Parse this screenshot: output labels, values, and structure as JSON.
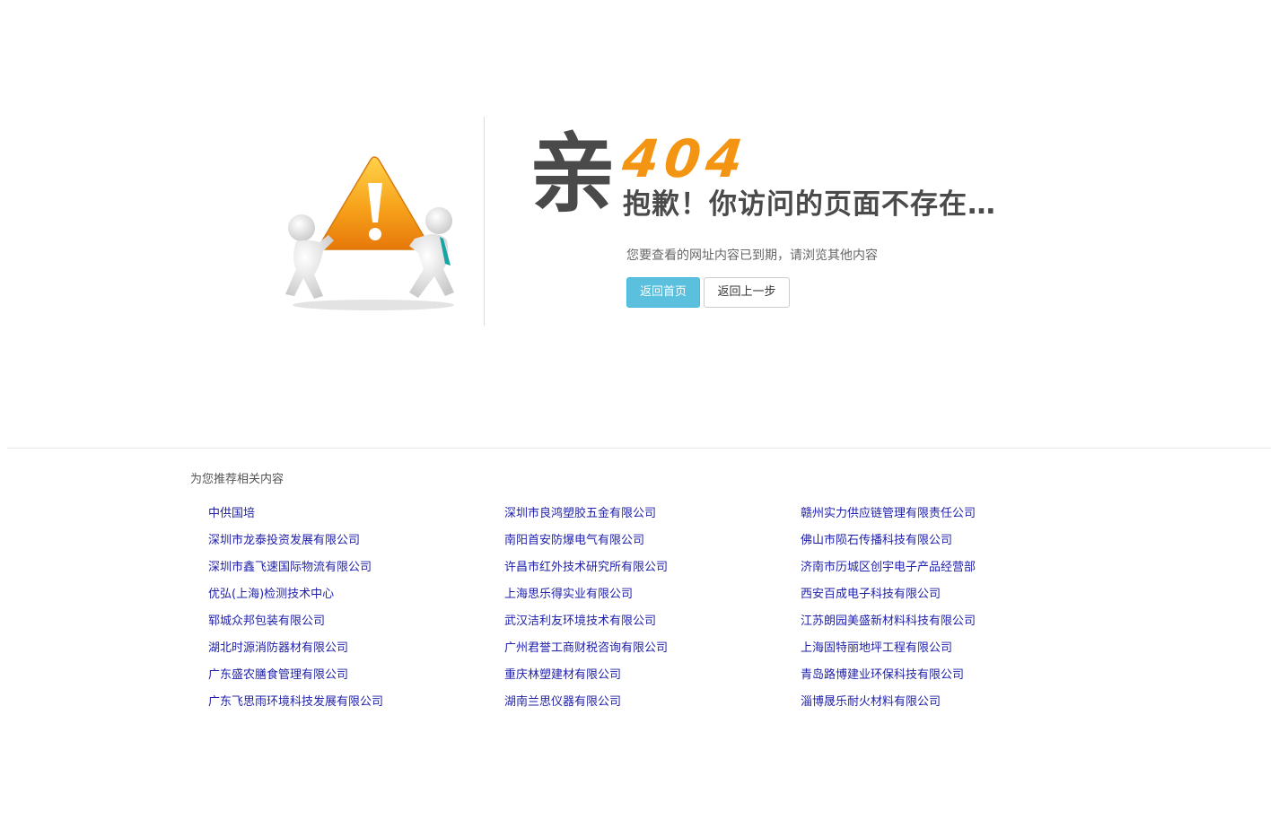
{
  "hero": {
    "qin_char": "亲",
    "error_code": "404",
    "sorry_text": "抱歉！你访问的页面不存在…",
    "sub_message": "您要查看的网址内容已到期，请浏览其他内容",
    "illustration_icon": "warning-sign-carried-by-figures-icon",
    "colors": {
      "accent": "#f39512",
      "headline": "#4a4a4a",
      "primary_button": "#5bc0de"
    }
  },
  "buttons": {
    "home_label": "返回首页",
    "back_label": "返回上一步"
  },
  "recommendations": {
    "title": "为您推荐相关内容",
    "link_color": "#1f1faa",
    "links": [
      "中供国培",
      "深圳市良鸿塑胶五金有限公司",
      "赣州实力供应链管理有限责任公司",
      "深圳市龙泰投资发展有限公司",
      "南阳首安防爆电气有限公司",
      "佛山市陨石传播科技有限公司",
      "深圳市鑫飞速国际物流有限公司",
      "许昌市红外技术研究所有限公司",
      "济南市历城区创宇电子产品经营部",
      "优弘(上海)检测技术中心",
      "上海思乐得实业有限公司",
      "西安百成电子科技有限公司",
      "郓城众邦包装有限公司",
      "武汉洁利友环境技术有限公司",
      "江苏朗园美盛新材料科技有限公司",
      "湖北时源消防器材有限公司",
      "广州君誉工商财税咨询有限公司",
      "上海固特丽地坪工程有限公司",
      "广东盛农膳食管理有限公司",
      "重庆林塑建材有限公司",
      "青岛路博建业环保科技有限公司",
      "广东飞思雨环境科技发展有限公司",
      "湖南兰思仪器有限公司",
      "淄博晟乐耐火材料有限公司"
    ]
  }
}
